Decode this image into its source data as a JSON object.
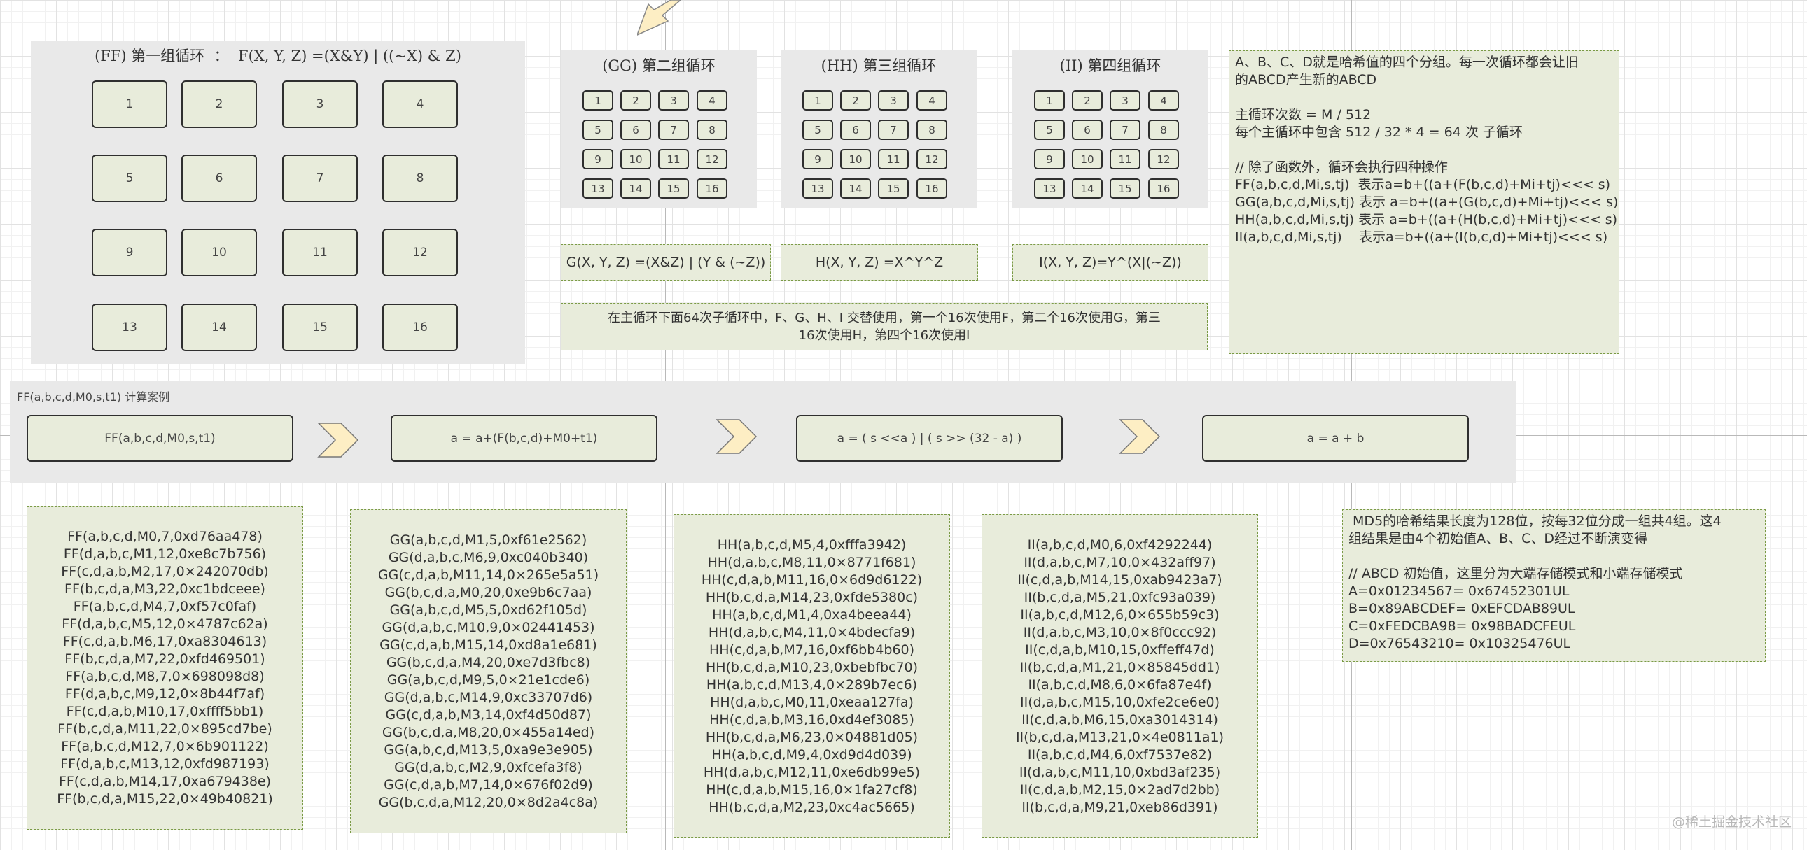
{
  "ff": {
    "title": "(FF) 第一组循环  ：  F(X, Y, Z) =(X&Y) | ((~X) & Z)",
    "boxes": [
      "1",
      "2",
      "3",
      "4",
      "5",
      "6",
      "7",
      "8",
      "9",
      "10",
      "11",
      "12",
      "13",
      "14",
      "15",
      "16"
    ]
  },
  "gg": {
    "title": "(GG) 第二组循环",
    "boxes": [
      "1",
      "2",
      "3",
      "4",
      "5",
      "6",
      "7",
      "8",
      "9",
      "10",
      "11",
      "12",
      "13",
      "14",
      "15",
      "16"
    ]
  },
  "hh": {
    "title": "(HH) 第三组循环",
    "boxes": [
      "1",
      "2",
      "3",
      "4",
      "5",
      "6",
      "7",
      "8",
      "9",
      "10",
      "11",
      "12",
      "13",
      "14",
      "15",
      "16"
    ]
  },
  "ii": {
    "title": "(II) 第四组循环",
    "boxes": [
      "1",
      "2",
      "3",
      "4",
      "5",
      "6",
      "7",
      "8",
      "9",
      "10",
      "11",
      "12",
      "13",
      "14",
      "15",
      "16"
    ]
  },
  "func_g": "G(X, Y, Z) =(X&Z) | (Y & (~Z))",
  "func_h": "H(X, Y, Z) =X^Y^Z",
  "func_i": "I(X, Y, Z)=Y^(X|(~Z))",
  "subloop_note": [
    "在主循环下面64次子循环中，F、G、H、I 交替使用，第一个16次使用F，第二个16次使用G，第三",
    "16次使用H，第四个16次使用I"
  ],
  "abcd_note": [
    "A、B、C、D就是哈希值的四个分组。每一次循环都会让旧",
    "的ABCD产生新的ABCD",
    "",
    "主循环次数 = M / 512",
    "每个主循环中包含 512 / 32 * 4 = 64 次 子循环",
    "",
    "// 除了函数外，循环会执行四种操作",
    "FF(a,b,c,d,Mi,s,tj)  表示a=b+((a+(F(b,c,d)+Mi+tj)<<< s)",
    "GG(a,b,c,d,Mi,s,tj) 表示 a=b+((a+(G(b,c,d)+Mi+tj)<<< s)",
    "HH(a,b,c,d,Mi,s,tj) 表示 a=b+((a+(H(b,c,d)+Mi+tj)<<< s)",
    "II(a,b,c,d,Mi,s,tj)    表示a=b+((a+(I(b,c,d)+Mi+tj)<<< s)"
  ],
  "example": {
    "label": "FF(a,b,c,d,M0,s,t1) 计算案例",
    "steps": [
      "FF(a,b,c,d,M0,s,t1)",
      "a = a+(F(b,c,d)+M0+t1)",
      "a = ( s <<a ) | ( s >> (32 - a) )",
      "a = a + b"
    ]
  },
  "ff_ops": [
    "FF(a,b,c,d,M0,7,0xd76aa478)",
    "FF(d,a,b,c,M1,12,0xe8c7b756)",
    "FF(c,d,a,b,M2,17,0×242070db)",
    "FF(b,c,d,a,M3,22,0xc1bdceee)",
    "FF(a,b,c,d,M4,7,0xf57c0faf)",
    "FF(d,a,b,c,M5,12,0×4787c62a)",
    "FF(c,d,a,b,M6,17,0xa8304613)",
    "FF(b,c,d,a,M7,22,0xfd469501)",
    "FF(a,b,c,d,M8,7,0×698098d8)",
    "FF(d,a,b,c,M9,12,0×8b44f7af)",
    "FF(c,d,a,b,M10,17,0xffff5bb1)",
    "FF(b,c,d,a,M11,22,0×895cd7be)",
    "FF(a,b,c,d,M12,7,0×6b901122)",
    "FF(d,a,b,c,M13,12,0xfd987193)",
    "FF(c,d,a,b,M14,17,0xa679438e)",
    "FF(b,c,d,a,M15,22,0×49b40821)"
  ],
  "gg_ops": [
    "GG(a,b,c,d,M1,5,0xf61e2562)",
    "GG(d,a,b,c,M6,9,0xc040b340)",
    "GG(c,d,a,b,M11,14,0×265e5a51)",
    "GG(b,c,d,a,M0,20,0xe9b6c7aa)",
    "GG(a,b,c,d,M5,5,0xd62f105d)",
    "GG(d,a,b,c,M10,9,0×02441453)",
    "GG(c,d,a,b,M15,14,0xd8a1e681)",
    "GG(b,c,d,a,M4,20,0xe7d3fbc8)",
    "GG(a,b,c,d,M9,5,0×21e1cde6)",
    "GG(d,a,b,c,M14,9,0xc33707d6)",
    "GG(c,d,a,b,M3,14,0xf4d50d87)",
    "GG(b,c,d,a,M8,20,0×455a14ed)",
    "GG(a,b,c,d,M13,5,0xa9e3e905)",
    "GG(d,a,b,c,M2,9,0xfcefa3f8)",
    "GG(c,d,a,b,M7,14,0×676f02d9)",
    "GG(b,c,d,a,M12,20,0×8d2a4c8a)"
  ],
  "hh_ops": [
    "HH(a,b,c,d,M5,4,0xfffa3942)",
    "HH(d,a,b,c,M8,11,0×8771f681)",
    "HH(c,d,a,b,M11,16,0×6d9d6122)",
    "HH(b,c,d,a,M14,23,0xfde5380c)",
    "HH(a,b,c,d,M1,4,0xa4beea44)",
    "HH(d,a,b,c,M4,11,0×4bdecfa9)",
    "HH(c,d,a,b,M7,16,0xf6bb4b60)",
    "HH(b,c,d,a,M10,23,0xbebfbc70)",
    "HH(a,b,c,d,M13,4,0×289b7ec6)",
    "HH(d,a,b,c,M0,11,0xeaa127fa)",
    "HH(c,d,a,b,M3,16,0xd4ef3085)",
    "HH(b,c,d,a,M6,23,0×04881d05)",
    "HH(a,b,c,d,M9,4,0xd9d4d039)",
    "HH(d,a,b,c,M12,11,0xe6db99e5)",
    "HH(c,d,a,b,M15,16,0×1fa27cf8)",
    "HH(b,c,d,a,M2,23,0xc4ac5665)"
  ],
  "ii_ops": [
    "II(a,b,c,d,M0,6,0xf4292244)",
    "II(d,a,b,c,M7,10,0×432aff97)",
    "II(c,d,a,b,M14,15,0xab9423a7)",
    "II(b,c,d,a,M5,21,0xfc93a039)",
    "II(a,b,c,d,M12,6,0×655b59c3)",
    "II(d,a,b,c,M3,10,0×8f0ccc92)",
    "II(c,d,a,b,M10,15,0xffeff47d)",
    "II(b,c,d,a,M1,21,0×85845dd1)",
    "II(a,b,c,d,M8,6,0×6fa87e4f)",
    "II(d,a,b,c,M15,10,0xfe2ce6e0)",
    "II(c,d,a,b,M6,15,0xa3014314)",
    "II(b,c,d,a,M13,21,0×4e0811a1)",
    "II(a,b,c,d,M4,6,0xf7537e82)",
    "II(d,a,b,c,M11,10,0xbd3af235)",
    "II(c,d,a,b,M2,15,0×2ad7d2bb)",
    "II(b,c,d,a,M9,21,0xeb86d391)"
  ],
  "md5_note": [
    " MD5的哈希结果长度为128位，按每32位分成一组共4组。这4",
    "组结果是由4个初始值A、B、C、D经过不断演变得",
    "",
    "// ABCD 初始值，这里分为大端存储模式和小端存储模式",
    "A=0x01234567= 0x67452301UL",
    "B=0x89ABCDEF= 0xEFCDAB89UL",
    "C=0xFEDCBA98= 0x98BADCFEUL",
    "D=0x76543210= 0x10325476UL"
  ],
  "watermark": "@稀土掘金技术社区",
  "colors": {
    "box_fill": "#e8ecdb",
    "panel": "#e9e9e9",
    "note_border": "#7a9a45",
    "chevron": "#fdeec4"
  }
}
